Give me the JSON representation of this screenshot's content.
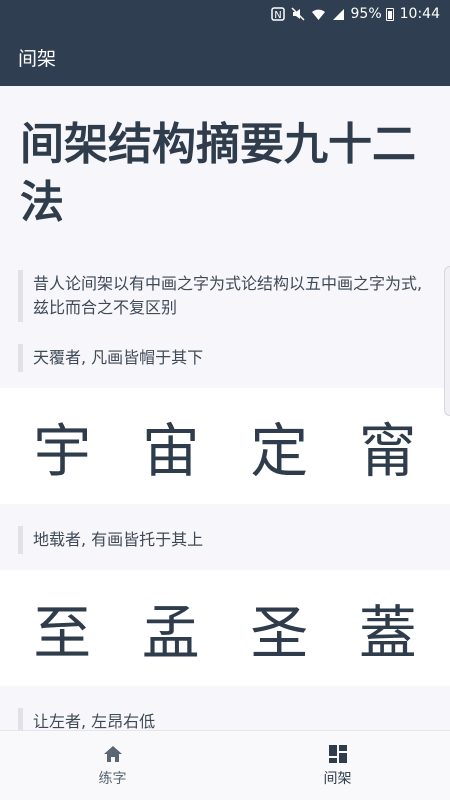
{
  "status_bar": {
    "battery": "95%",
    "time": "10:44"
  },
  "app_bar": {
    "title": "间架"
  },
  "article": {
    "title": "间架结构摘要九十二法",
    "intro": "昔人论间架以有中画之字为式论结构以五中画之字为式,兹比而合之不复区别",
    "sections": [
      {
        "heading": "天覆者, 凡画皆帽于其下",
        "chars": [
          "宇",
          "宙",
          "定",
          "甯"
        ]
      },
      {
        "heading": "地载者, 有画皆托于其上",
        "chars": [
          "至",
          "孟",
          "圣",
          "蓋"
        ]
      },
      {
        "heading": "让左者, 左昂右低"
      }
    ]
  },
  "bottom_nav": {
    "items": [
      {
        "label": "练字",
        "icon": "home-icon"
      },
      {
        "label": "间架",
        "icon": "dashboard-icon"
      }
    ],
    "active_index": 1
  },
  "colors": {
    "app_bar": "#2f3e50",
    "background": "#f7f6fa",
    "text": "#2f3c4c",
    "quote_bar": "#e3e1e8"
  }
}
